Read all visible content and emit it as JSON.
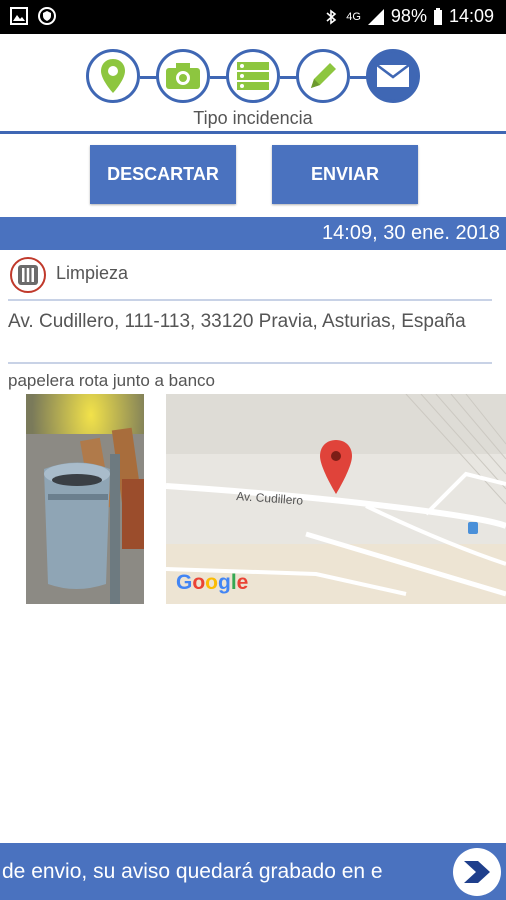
{
  "status_bar": {
    "network": "4G",
    "battery": "98%",
    "time": "14:09",
    "icons": [
      "gallery-icon",
      "shield-icon",
      "bluetooth-icon",
      "signal-icon",
      "battery-icon"
    ]
  },
  "steps": {
    "items": [
      {
        "icon": "location-pin-icon",
        "state": "done"
      },
      {
        "icon": "camera-icon",
        "state": "done"
      },
      {
        "icon": "list-icon",
        "state": "done"
      },
      {
        "icon": "pencil-icon",
        "state": "done"
      },
      {
        "icon": "envelope-icon",
        "state": "active"
      }
    ],
    "caption": "Tipo incidencia",
    "colors": {
      "accent": "#3f67b4",
      "done_icon": "#8dc63f"
    }
  },
  "actions": {
    "discard_label": "DESCARTAR",
    "send_label": "ENVIAR"
  },
  "report": {
    "datetime": "14:09, 30 ene. 2018",
    "category": "Limpieza",
    "address": "Av. Cudillero, 111-113, 33120 Pravia, Asturias, España",
    "description": "papelera rota junto a banco"
  },
  "map": {
    "street_label": "Av. Cudillero",
    "provider": "Google"
  },
  "bottom_bar": {
    "ticker": "de envio, su aviso quedará grabado en e"
  }
}
